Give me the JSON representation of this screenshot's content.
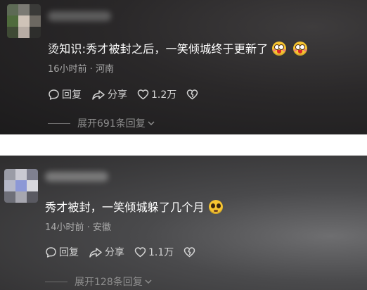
{
  "comments": [
    {
      "text": "烫知识:秀才被封之后，一笑倾城终于更新了",
      "emojis": [
        "blush-emoji",
        "blush-emoji"
      ],
      "time": "16小时前",
      "sep": "·",
      "location": "河南",
      "reply_label": "回复",
      "share_label": "分享",
      "like_count": "1.2万",
      "more_replies": "展开691条回复"
    },
    {
      "text": "秀才被封，一笑倾城躲了几个月",
      "emojis": [
        "pleading-emoji"
      ],
      "time": "14小时前",
      "sep": "·",
      "location": "安徽",
      "reply_label": "回复",
      "share_label": "分享",
      "like_count": "1.1万",
      "more_replies": "展开128条回复"
    }
  ],
  "icons": {
    "reply": "comment-bubble-icon",
    "share": "share-arrow-icon",
    "like": "heart-icon",
    "dislike": "broken-heart-icon",
    "expand": "chevron-down-icon"
  },
  "colors": {
    "text": "#ffffff",
    "meta": "#a9a9a9",
    "action": "#d4d4d4",
    "replies": "#8e8e8e"
  }
}
